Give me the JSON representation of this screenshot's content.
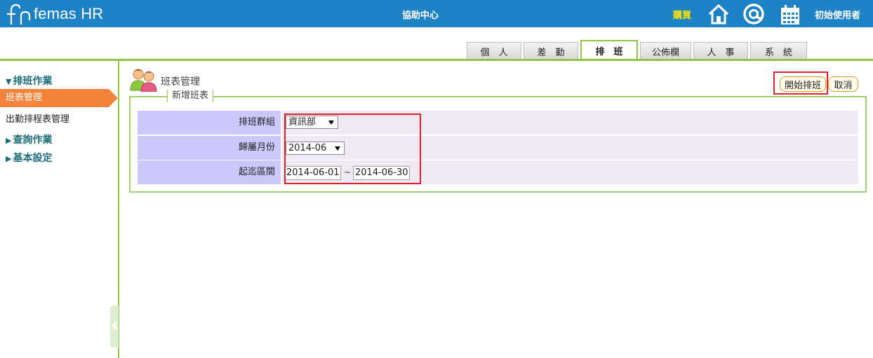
{
  "header": {
    "logo_text": "femas HR",
    "help_center": "協助中心",
    "buy": "購買",
    "user": "初始使用者",
    "icons": [
      "home-icon",
      "at-icon",
      "calendar-icon"
    ],
    "colors": {
      "bar": "#1d82c6",
      "buy": "#ffe600",
      "accent": "#8dc63f",
      "active_side": "#f4843b"
    }
  },
  "tabs": [
    {
      "label": "個　人",
      "active": false
    },
    {
      "label": "差　勤",
      "active": false
    },
    {
      "label": "排　班",
      "active": true
    },
    {
      "label": "公佈欄",
      "active": false
    },
    {
      "label": "人　事",
      "active": false
    },
    {
      "label": "系　統",
      "active": false
    }
  ],
  "sidebar": {
    "section1": "排班作業",
    "active_item": "班表管理",
    "item2": "出勤排程表管理",
    "section2": "查詢作業",
    "section3": "基本設定"
  },
  "main": {
    "title": "班表管理",
    "start_button": "開始排班",
    "cancel_button": "取消",
    "legend": "新增班表",
    "form": {
      "group_label": "排班群組",
      "group_value": "資訊部",
      "month_label": "歸屬月份",
      "month_value": "2014-06",
      "range_label": "起迄區間",
      "date_from": "2014-06-01",
      "date_sep": "~",
      "date_to": "2014-06-30"
    }
  }
}
